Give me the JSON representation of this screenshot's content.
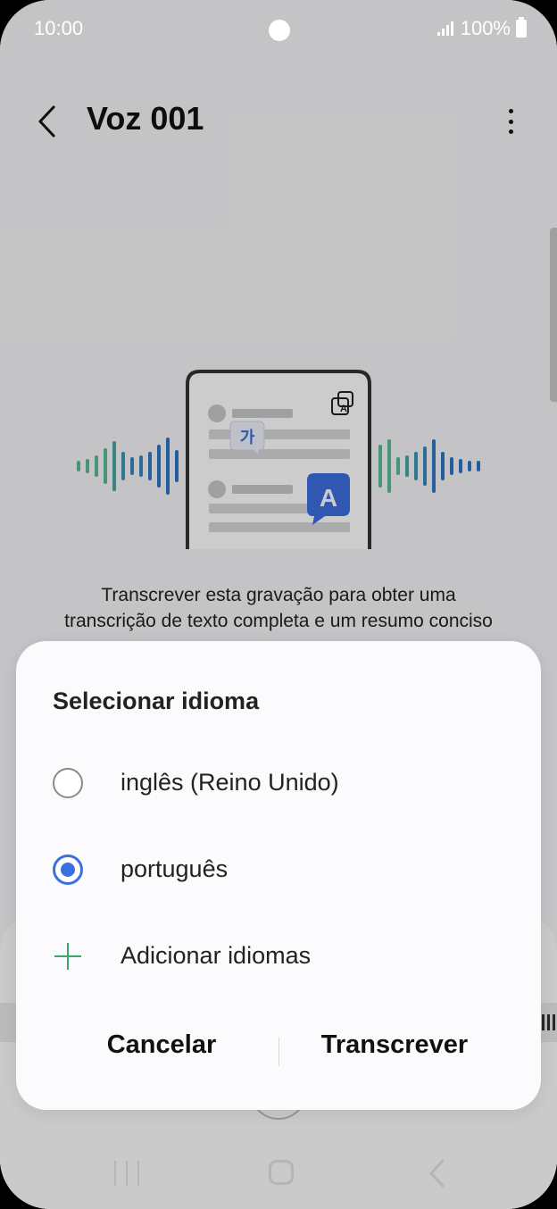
{
  "status_bar": {
    "time": "10:00",
    "battery": "100%"
  },
  "app_bar": {
    "title": "Voz 001"
  },
  "illustration": {
    "korean_char": "가",
    "latin_char": "A"
  },
  "intro": {
    "line1": "Transcrever esta gravação para obter uma",
    "line2": "transcrição de texto completa e um resumo conciso"
  },
  "dialog": {
    "title": "Selecionar idioma",
    "options": [
      {
        "label": "inglês (Reino Unido)",
        "selected": false
      },
      {
        "label": "português",
        "selected": true
      }
    ],
    "add_label": "Adicionar idiomas",
    "cancel_label": "Cancelar",
    "confirm_label": "Transcrever"
  },
  "colors": {
    "accent": "#3c6fe0",
    "add_icon": "#3aa866",
    "wave_green": "#5bb99a",
    "wave_blue": "#2e73c8"
  }
}
